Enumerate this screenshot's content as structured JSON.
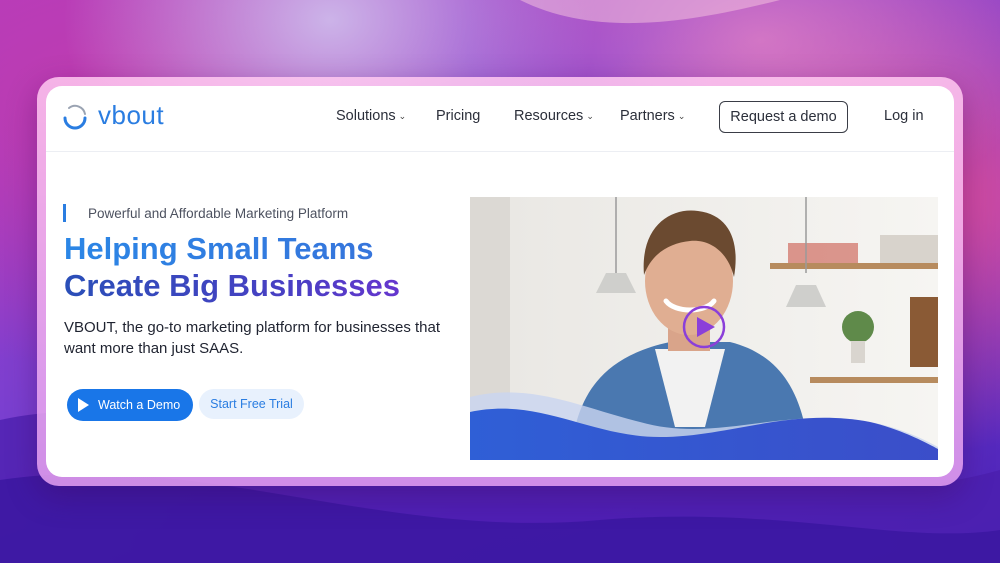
{
  "brand": {
    "name": "vbout",
    "accent": "#2a7de1"
  },
  "nav": {
    "items": [
      {
        "label": "Solutions",
        "has_dropdown": true
      },
      {
        "label": "Pricing",
        "has_dropdown": false
      },
      {
        "label": "Resources",
        "has_dropdown": true
      },
      {
        "label": "Partners",
        "has_dropdown": true
      }
    ],
    "demo_label": "Request a demo",
    "login_label": "Log in"
  },
  "hero": {
    "eyebrow": "Powerful and Affordable Marketing Platform",
    "headline_line1": "Helping Small Teams",
    "headline_line2": "Create Big Businesses",
    "subtitle": "VBOUT, the go-to marketing platform for businesses that want more than just SAAS.",
    "watch_label": "Watch a Demo",
    "trial_label": "Start Free Trial"
  },
  "icons": [
    "vbout-logo-icon",
    "chevron-down-icon",
    "play-icon",
    "video-play-icon"
  ]
}
